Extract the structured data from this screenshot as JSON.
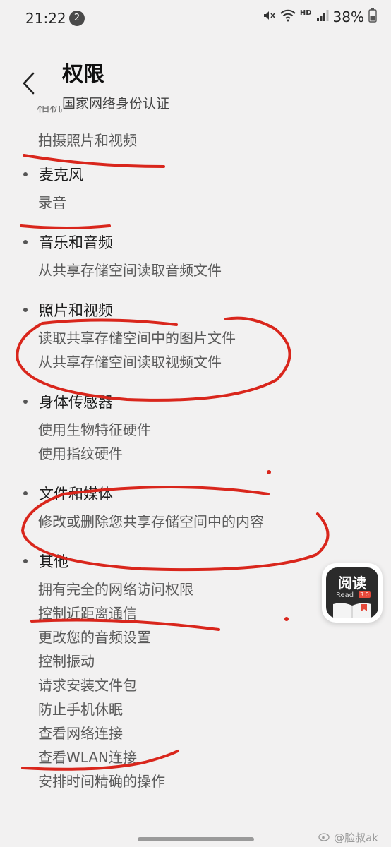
{
  "status_bar": {
    "time": "21:22",
    "notification_count": "2",
    "battery": "38%",
    "network": "HD"
  },
  "header": {
    "title": "权限",
    "subtitle": "国家网络身份认证",
    "cutoff_text": "相机"
  },
  "groups": [
    {
      "title": null,
      "items": [
        "拍摄照片和视频"
      ]
    },
    {
      "title": "麦克风",
      "items": [
        "录音"
      ]
    },
    {
      "title": "音乐和音频",
      "items": [
        "从共享存储空间读取音频文件"
      ]
    },
    {
      "title": "照片和视频",
      "items": [
        "读取共享存储空间中的图片文件",
        "从共享存储空间读取视频文件"
      ]
    },
    {
      "title": "身体传感器",
      "items": [
        "使用生物特征硬件",
        "使用指纹硬件"
      ]
    },
    {
      "title": "文件和媒体",
      "items": [
        "修改或删除您共享存储空间中的内容"
      ]
    },
    {
      "title": "其他",
      "items": [
        "拥有完全的网络访问权限",
        "控制近距离通信",
        "更改您的音频设置",
        "控制振动",
        "请求安装文件包",
        "防止手机休眠",
        "查看网络连接",
        "查看WLAN连接",
        "安排时间精确的操作"
      ]
    }
  ],
  "floating_app": {
    "name": "阅读",
    "subtitle": "Read",
    "version": "3.0"
  },
  "watermark": "@脸叔ak",
  "colors": {
    "background": "#f2f1f1",
    "annotation_red": "#d9261c"
  }
}
